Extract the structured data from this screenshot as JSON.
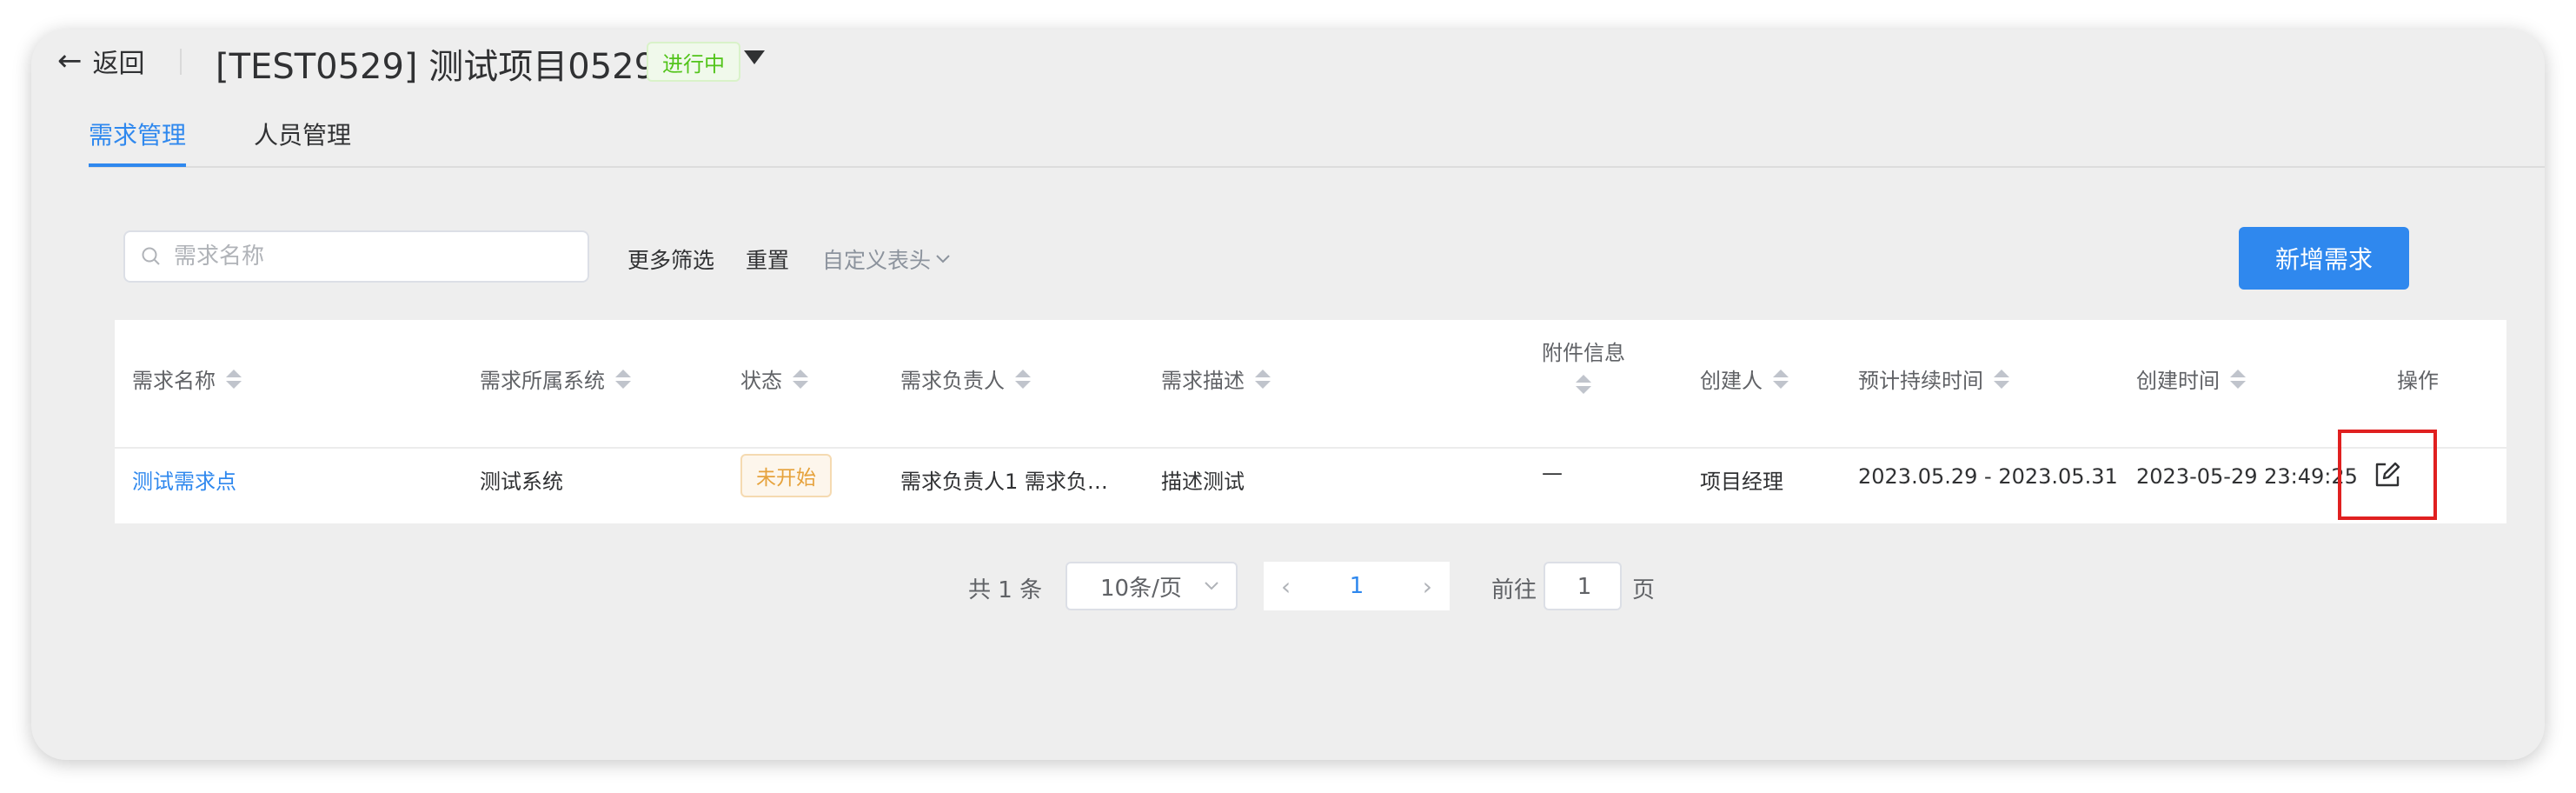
{
  "header": {
    "back_label": "返回",
    "project_title": "[TEST0529] 测试项目0529",
    "status_label": "进行中"
  },
  "tabs": [
    {
      "label": "需求管理",
      "active": true
    },
    {
      "label": "人员管理",
      "active": false
    }
  ],
  "toolbar": {
    "search_placeholder": "需求名称",
    "more_filters": "更多筛选",
    "reset": "重置",
    "custom_columns": "自定义表头",
    "add_button": "新增需求"
  },
  "table": {
    "columns": [
      "需求名称",
      "需求所属系统",
      "状态",
      "需求负责人",
      "需求描述",
      "附件信息",
      "创建人",
      "预计持续时间",
      "创建时间",
      "操作"
    ],
    "rows": [
      {
        "name": "测试需求点",
        "system": "测试系统",
        "status": "未开始",
        "owner": "需求负责人1 需求负…",
        "description": "描述测试",
        "attachment": "—",
        "creator": "项目经理",
        "duration": "2023.05.29 - 2023.05.31",
        "created_at": "2023-05-29 23:49:25"
      }
    ]
  },
  "pagination": {
    "total": "共 1 条",
    "page_size": "10条/页",
    "current_page": "1",
    "goto_label": "前往",
    "goto_value": "1",
    "page_suffix": "页"
  },
  "colors": {
    "primary": "#2f88ee",
    "running_green": "#52c41a",
    "pending_orange": "#e6a23c",
    "highlight_red": "#e02020",
    "panel_bg": "#eeeeee"
  }
}
